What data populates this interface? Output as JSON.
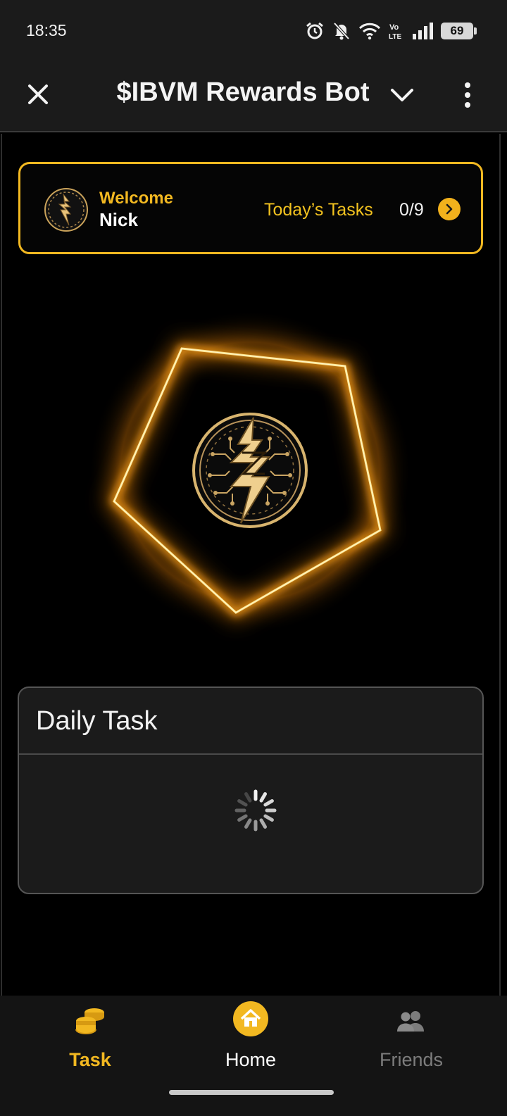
{
  "status_bar": {
    "time": "18:35",
    "battery": "69",
    "network": "Vo LTE",
    "icons": [
      "alarm-icon",
      "bell-muted-icon",
      "wifi-icon",
      "volte-icon",
      "signal-icon",
      "battery-icon"
    ]
  },
  "app_bar": {
    "title": "$IBVM Rewards Bot",
    "icons": [
      "close-icon",
      "chevron-down-icon",
      "more-vertical-icon"
    ]
  },
  "welcome_card": {
    "greeting": "Welcome",
    "user_name": "Nick",
    "tasks_label": "Today’s Tasks",
    "tasks_count": "0/9"
  },
  "daily_task": {
    "title": "Daily Task",
    "loading": true
  },
  "bottom_nav": {
    "items": [
      {
        "label": "Task",
        "icon": "coins-icon",
        "active": true
      },
      {
        "label": "Home",
        "icon": "home-icon",
        "active": false
      },
      {
        "label": "Friends",
        "icon": "friends-icon",
        "active": false
      }
    ]
  },
  "colors": {
    "accent": "#f2b821",
    "background": "#000000",
    "bar": "#1b1b1b",
    "card": "#1b1b1b",
    "inactive": "#7c7c7c"
  }
}
